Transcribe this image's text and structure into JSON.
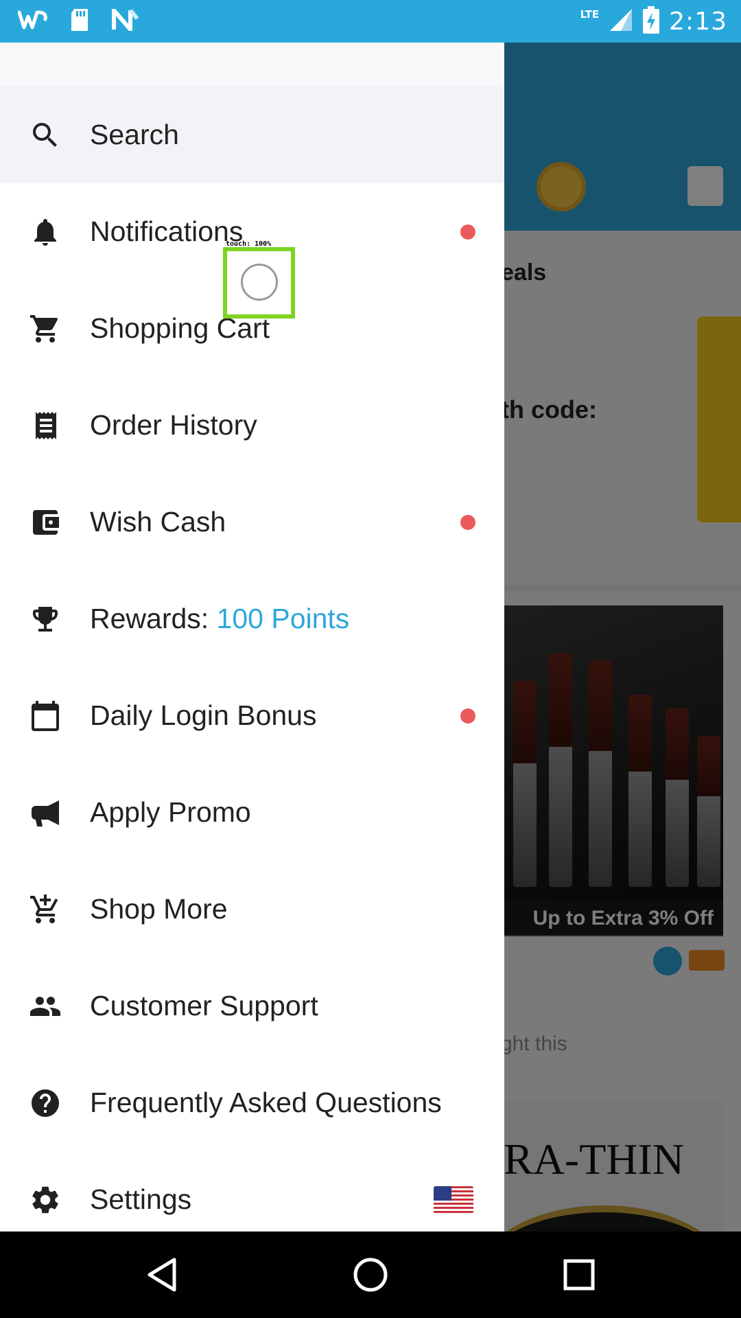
{
  "status_bar": {
    "time": "2:13",
    "network_label": "LTE",
    "notification_icons": [
      "wish-app-icon",
      "sd-card-icon",
      "n-app-icon"
    ],
    "background_color": "#29a8dc"
  },
  "background_app": {
    "deals_heading_partial": "eals",
    "code_text_partial": "th code:",
    "product_badge": "Up to Extra 3% Off",
    "bought_text_partial": "ght this",
    "watch_banner_text_partial": "RA-THIN",
    "accent_color": "#2ea6db"
  },
  "drawer": {
    "items": [
      {
        "label": "Search",
        "icon": "search-icon"
      },
      {
        "label": "Notifications",
        "icon": "bell-icon",
        "badge_dot": true
      },
      {
        "label": "Shopping Cart",
        "icon": "cart-icon"
      },
      {
        "label": "Order History",
        "icon": "receipt-icon"
      },
      {
        "label": "Wish Cash",
        "icon": "wallet-icon",
        "badge_dot": true
      },
      {
        "label": "Rewards: ",
        "highlight": "100 Points",
        "icon": "trophy-icon"
      },
      {
        "label": "Daily Login Bonus",
        "icon": "calendar-icon",
        "badge_dot": true
      },
      {
        "label": "Apply Promo",
        "icon": "megaphone-icon"
      },
      {
        "label": "Shop More",
        "icon": "cart-add-icon"
      },
      {
        "label": "Customer Support",
        "icon": "people-icon"
      },
      {
        "label": "Frequently Asked Questions",
        "icon": "help-icon"
      },
      {
        "label": "Settings",
        "icon": "gear-icon",
        "flag": "us-flag-icon"
      }
    ],
    "highlight_color": "#2ea6db",
    "badge_color": "#ea5a5a"
  },
  "touch_indicator": {
    "label": "touch: 100%",
    "color": "#7ed321"
  },
  "nav_bar": {
    "buttons": [
      "back-icon",
      "home-icon",
      "recents-icon"
    ]
  }
}
